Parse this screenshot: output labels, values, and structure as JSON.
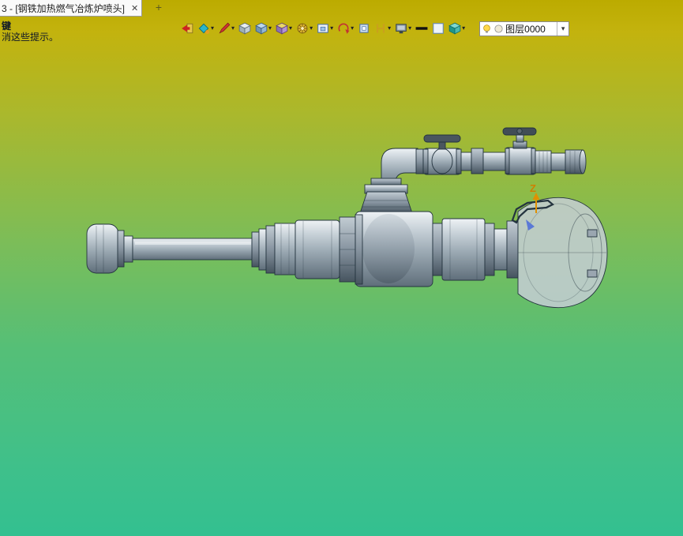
{
  "tab_bar": {
    "active_tab": {
      "label": "3 - [钢铁加热燃气冶炼炉喷头]",
      "close_glyph": "✕"
    },
    "new_tab_glyph": "+"
  },
  "hints": {
    "line1": "键",
    "line2": "消这些提示。"
  },
  "toolbar": {
    "dropdown_glyph": "▾",
    "icons": [
      "exit-icon",
      "render-style-icon",
      "sketch-pencil-icon",
      "view-cube-icon",
      "display-mode-cube-icon",
      "shade-cube-icon",
      "view-wheel-icon",
      "zoom-window-icon",
      "orient-arrow-icon",
      "plane-icon",
      "grid-ruler-icon",
      "screen-display-icon",
      "line-width-icon",
      "background-swatch-icon",
      "material-cube-icon",
      "layer-bulb-icon",
      "layer-sphere-icon"
    ],
    "layer_combo": {
      "value": "图层0000"
    }
  },
  "viewport": {
    "axis_z_label": "Z",
    "background_gradient": {
      "top": "#bcab00",
      "middle": "#7cbd58",
      "bottom": "#33c090"
    },
    "accent_colors": {
      "axis_z": "#e09000",
      "axis_blue": "#5b79d6",
      "metal_dark": "#24343f"
    }
  }
}
